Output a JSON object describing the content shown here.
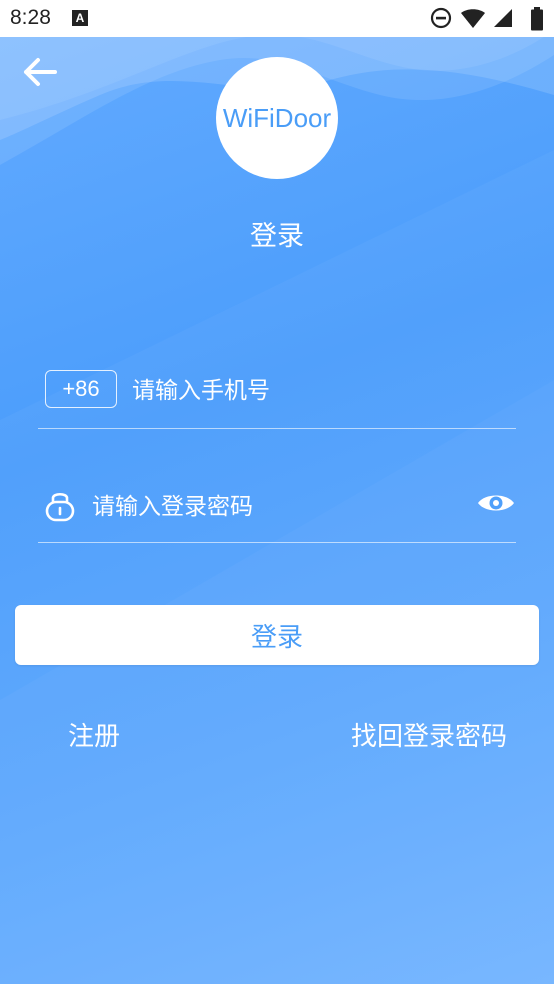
{
  "status_bar": {
    "time": "8:28",
    "notification_badge": "A",
    "icons": [
      "do-not-disturb-icon",
      "wifi-icon",
      "signal-icon",
      "battery-icon"
    ]
  },
  "header": {
    "back_icon": "arrow-left-icon",
    "logo_text": "WiFiDoor",
    "title": "登录"
  },
  "form": {
    "country_code": "+86",
    "phone_placeholder": "请输入手机号",
    "phone_value": "",
    "password_icon": "lock-icon",
    "password_placeholder": "请输入登录密码",
    "password_value": "",
    "visibility_icon": "eye-icon",
    "submit_label": "登录"
  },
  "links": {
    "register": "注册",
    "forgot_password": "找回登录密码"
  },
  "colors": {
    "background": "#4b9dfb",
    "accent": "#4a9df7",
    "text_on_primary": "#ffffff"
  }
}
